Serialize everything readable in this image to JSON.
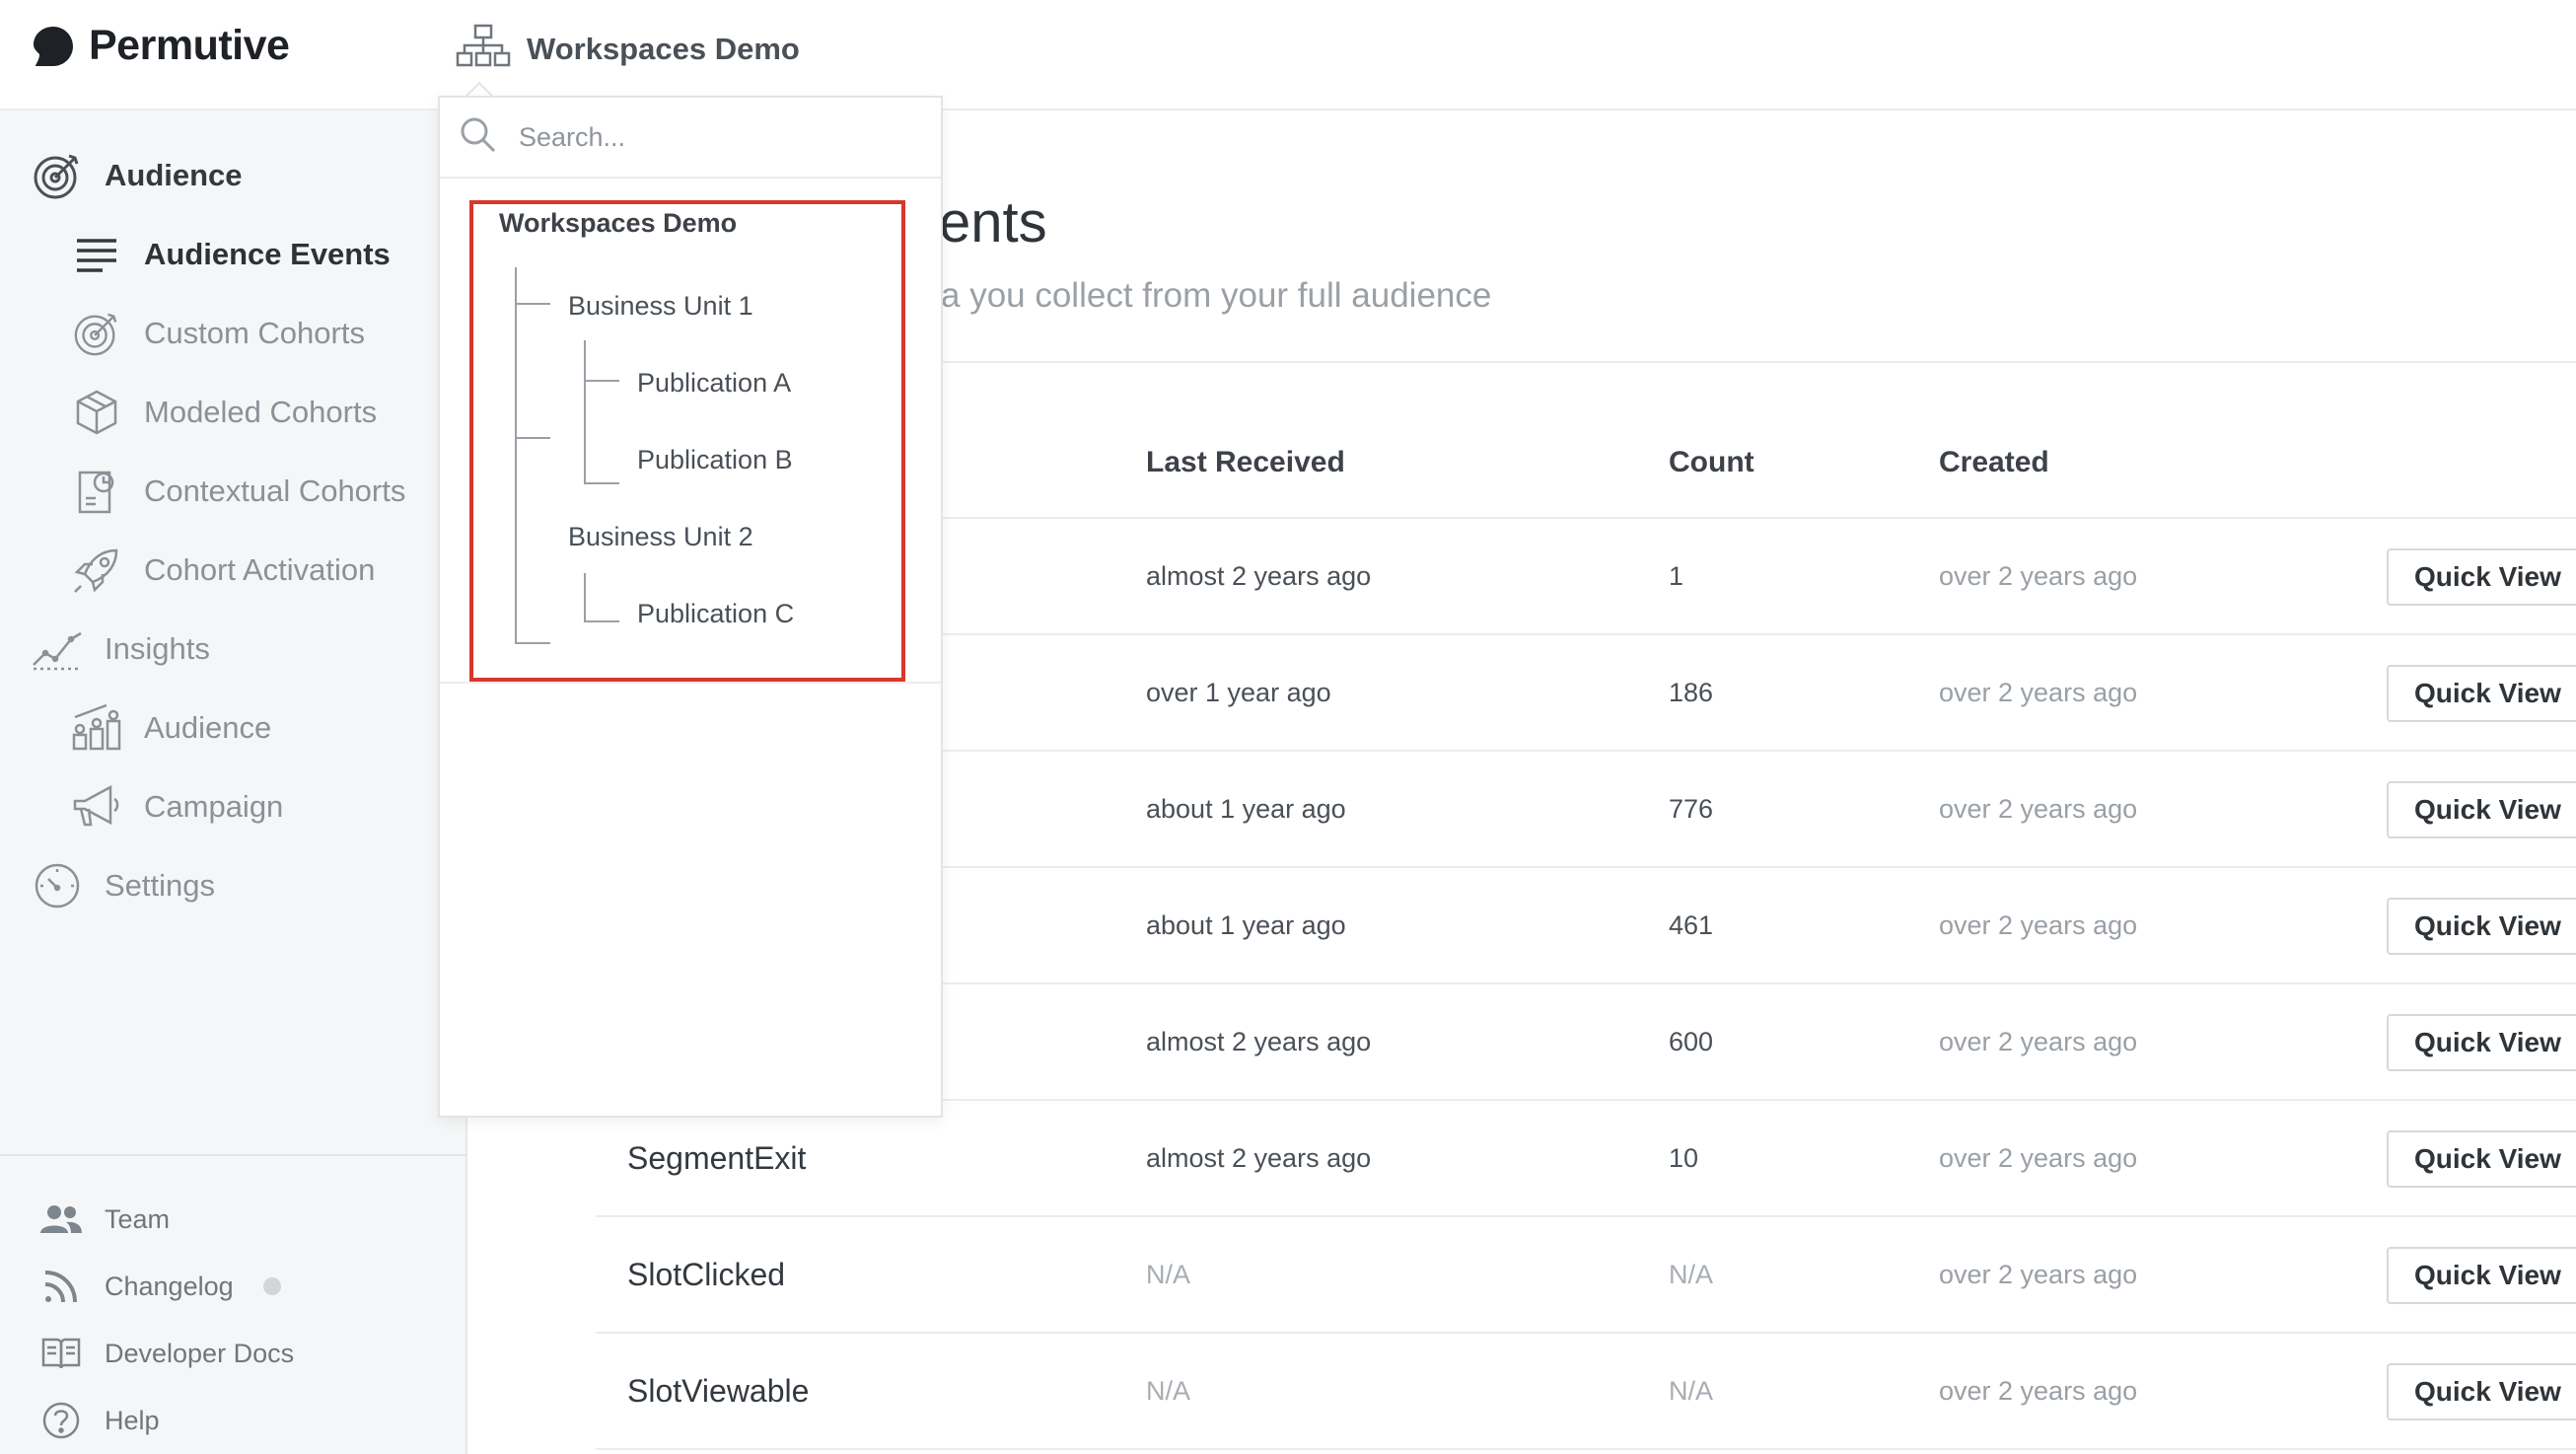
{
  "brand": {
    "name": "Permutive"
  },
  "workspace_switcher": {
    "label": "Workspaces Demo"
  },
  "sidebar": {
    "sections": [
      {
        "label": "Audience",
        "icon": "target-icon"
      },
      {
        "label": "Insights",
        "icon": "trend-icon"
      },
      {
        "label": "Settings",
        "icon": "gauge-icon"
      }
    ],
    "audience_items": [
      {
        "label": "Audience Events",
        "icon": "list-icon",
        "active": true
      },
      {
        "label": "Custom Cohorts",
        "icon": "target-icon"
      },
      {
        "label": "Modeled Cohorts",
        "icon": "cube-icon"
      },
      {
        "label": "Contextual Cohorts",
        "icon": "document-icon"
      },
      {
        "label": "Cohort Activation",
        "icon": "rocket-icon"
      }
    ],
    "insights_items": [
      {
        "label": "Audience",
        "icon": "people-chart-icon"
      },
      {
        "label": "Campaign",
        "icon": "megaphone-icon"
      }
    ],
    "footer": [
      {
        "label": "Team",
        "icon": "team-icon"
      },
      {
        "label": "Changelog",
        "icon": "rss-icon"
      },
      {
        "label": "Developer Docs",
        "icon": "book-icon"
      },
      {
        "label": "Help",
        "icon": "help-icon"
      }
    ]
  },
  "page": {
    "title_visible": "ents",
    "subtitle_visible": "a you collect from your full audience"
  },
  "table": {
    "headers": {
      "last": "Last Received",
      "count": "Count",
      "created": "Created"
    },
    "action_label": "Quick View",
    "rows": [
      {
        "name": "",
        "last": "almost 2 years ago",
        "count": "1",
        "created": "over 2 years ago"
      },
      {
        "name": "",
        "last": "over 1 year ago",
        "count": "186",
        "created": "over 2 years ago"
      },
      {
        "name": "",
        "last": "about 1 year ago",
        "count": "776",
        "created": "over 2 years ago"
      },
      {
        "name": "",
        "last": "about 1 year ago",
        "count": "461",
        "created": "over 2 years ago"
      },
      {
        "name": "",
        "last": "almost 2 years ago",
        "count": "600",
        "created": "over 2 years ago"
      },
      {
        "name": "SegmentExit",
        "last": "almost 2 years ago",
        "count": "10",
        "created": "over 2 years ago"
      },
      {
        "name": "SlotClicked",
        "last": "N/A",
        "count": "N/A",
        "created": "over 2 years ago"
      },
      {
        "name": "SlotViewable",
        "last": "N/A",
        "count": "N/A",
        "created": "over 2 years ago"
      }
    ]
  },
  "dropdown": {
    "search_placeholder": "Search...",
    "tree": {
      "root": "Workspaces Demo",
      "bu1": "Business Unit 1",
      "pubA": "Publication A",
      "pubB": "Publication B",
      "bu2": "Business Unit 2",
      "pubC": "Publication C"
    }
  },
  "colors": {
    "highlight": "#d9372b",
    "sidebar_bg": "#f5f6f7",
    "accent_text": "#2d3237"
  }
}
